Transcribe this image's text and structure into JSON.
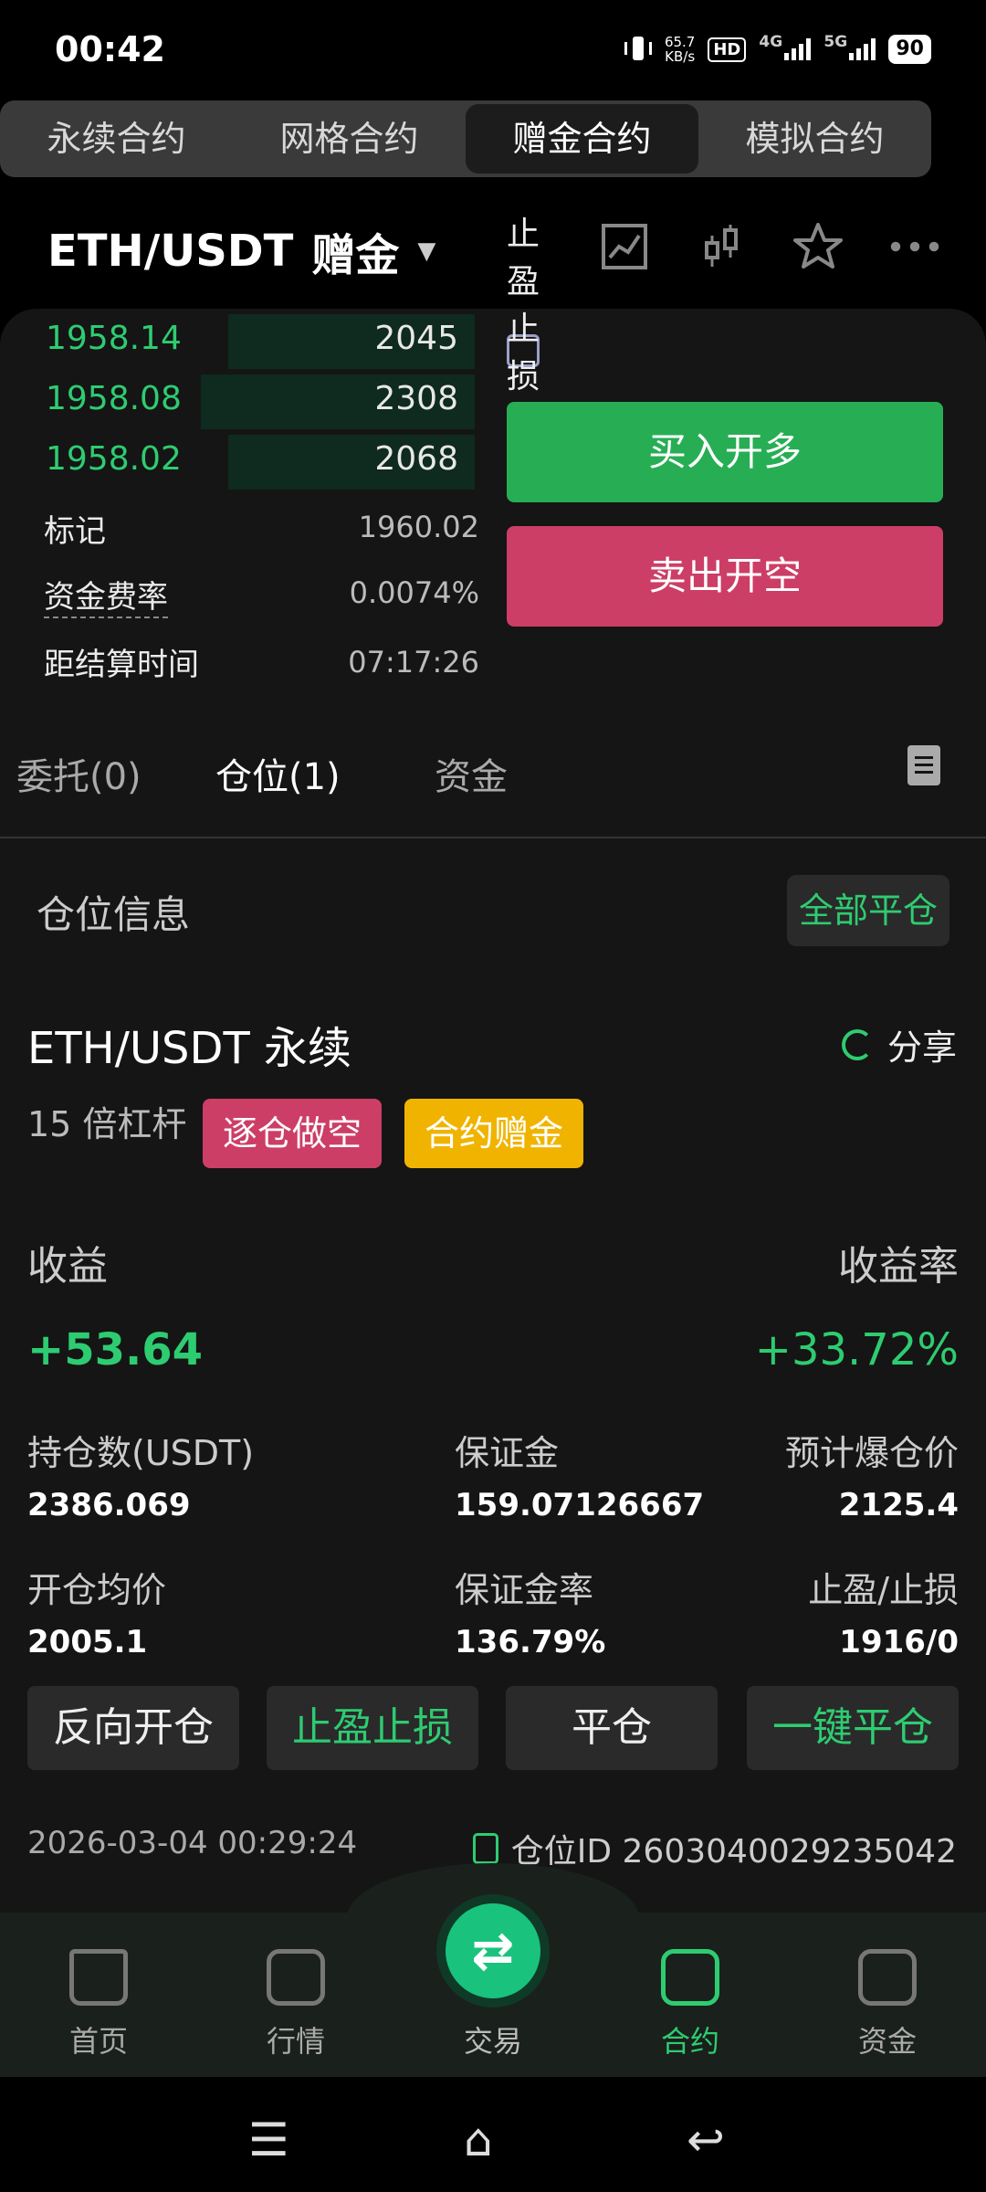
{
  "status": {
    "time": "00:42",
    "speed_top": "65.7",
    "speed_unit": "KB/s",
    "hd": "HD",
    "net1": "4G",
    "net2": "5G",
    "battery": "90"
  },
  "top_tabs": [
    "永续合约",
    "网格合约",
    "赠金合约",
    "模拟合约"
  ],
  "pair": {
    "name": "ETH/USDT",
    "tag": "赠金"
  },
  "orderbook": [
    {
      "price": "1958.14",
      "qty": "2045"
    },
    {
      "price": "1958.08",
      "qty": "2308"
    },
    {
      "price": "1958.02",
      "qty": "2068"
    }
  ],
  "stats": {
    "mark_label": "标记",
    "mark_value": "1960.02",
    "funding_label": "资金费率",
    "funding_value": "0.0074%",
    "settle_label": "距结算时间",
    "settle_value": "07:17:26"
  },
  "order": {
    "tpsl_label": "止盈止损设置",
    "buy": "买入开多",
    "sell": "卖出开空"
  },
  "sub_tabs": {
    "orders": "委托(0)",
    "positions": "仓位(1)",
    "funds": "资金"
  },
  "position_section": {
    "title": "仓位信息",
    "close_all": "全部平仓"
  },
  "position": {
    "symbol": "ETH/USDT 永续",
    "share": "分享",
    "leverage": "15 倍杠杆",
    "badge_side": "逐仓做空",
    "badge_type": "合约赠金",
    "pnl_label": "收益",
    "pnl_rate_label": "收益率",
    "pnl": "+53.64",
    "pnl_rate": "+33.72%",
    "size_label": "持仓数(USDT)",
    "size": "2386.069",
    "margin_label": "保证金",
    "margin": "159.07126667",
    "liq_label": "预计爆仓价",
    "liq": "2125.4",
    "entry_label": "开仓均价",
    "entry": "2005.1",
    "margin_rate_label": "保证金率",
    "margin_rate": "136.79%",
    "tpsl_label": "止盈/止损",
    "tpsl": "1916/0",
    "btn_reverse": "反向开仓",
    "btn_tpsl": "止盈止损",
    "btn_close": "平仓",
    "btn_quick_close": "一键平仓",
    "timestamp": "2026-03-04 00:29:24",
    "position_id": "仓位ID 2603040029235042"
  },
  "nav": {
    "home": "首页",
    "market": "行情",
    "trade": "交易",
    "contract": "合约",
    "assets": "资金"
  },
  "colors": {
    "green": "#2ecc71",
    "red": "#cc3e66",
    "yellow": "#f0b400",
    "bg": "#151515"
  }
}
